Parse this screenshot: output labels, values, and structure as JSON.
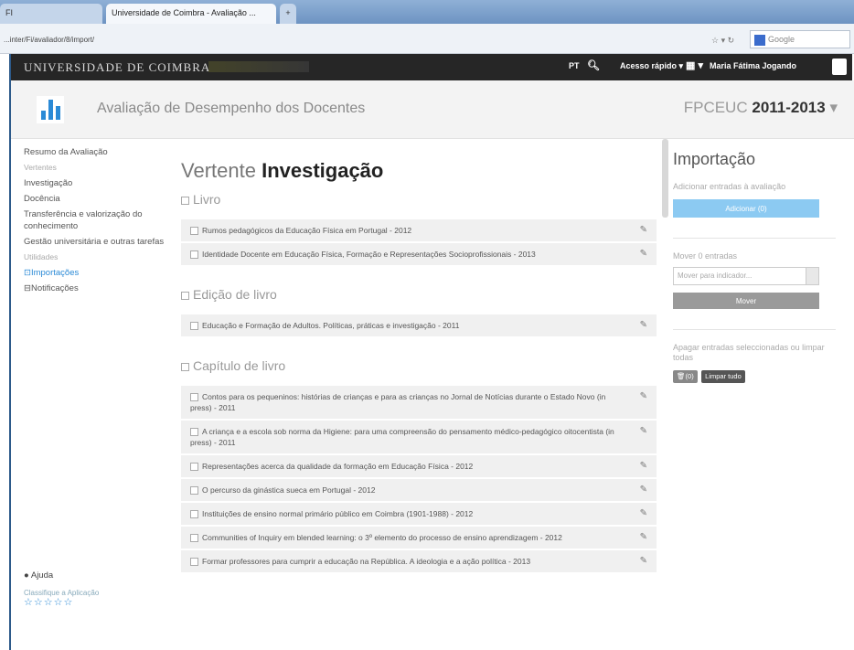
{
  "browser": {
    "tab_prev": "FI",
    "tab_active": "Universidade de Coimbra - Avaliação ...",
    "tab_new": "+",
    "url": "...inter/Fi/avaliador/8/import/",
    "google": "Google"
  },
  "topbar": {
    "logo": "UNIVERSIDADE DE COIMBRA",
    "lang": "PT",
    "quick_access": "Acesso rápido",
    "user_name": "Maria Fátima Jogando"
  },
  "header": {
    "title": "Avaliação de Desempenho dos Docentes",
    "context_org": "FPCEUC",
    "context_period": "2011-2013"
  },
  "sidebar": {
    "summary": "Resumo da Avaliação",
    "vertentes_label": "Vertentes",
    "items": [
      "Investigação",
      "Docência",
      "Transferência e valorização do conhecimento",
      "Gestão universitária e outras tarefas"
    ],
    "utilities_label": "Utilidades",
    "imports": "Importações",
    "notifications": "Notificações",
    "help": "Ajuda",
    "feedback": "Classifique a Aplicação"
  },
  "main": {
    "heading_prefix": "Vertente",
    "heading_main": "Investigação",
    "sections": [
      {
        "title": "Livro",
        "rows": [
          "Rumos pedagógicos da Educação Física em Portugal - 2012",
          "Identidade Docente em Educação Física, Formação e Representações Socioprofissionais - 2013"
        ]
      },
      {
        "title": "Edição de livro",
        "rows": [
          "Educação e Formação de Adultos. Políticas, práticas e investigação - 2011"
        ]
      },
      {
        "title": "Capítulo de livro",
        "rows": [
          "Contos para os pequeninos: histórias de crianças e para as crianças no Jornal de Notícias durante o Estado Novo (in press) - 2011",
          "A criança e a escola sob norma da Higiene: para uma compreensão do pensamento médico-pedagógico oitocentista (in press) - 2011",
          "Representações acerca da qualidade da formação em Educação Física - 2012",
          "O percurso da ginástica sueca em Portugal - 2012",
          "Instituições de ensino normal primário público em Coimbra (1901-1988) - 2012",
          "Communities of Inquiry em blended learning: o 3º elemento do processo de ensino aprendizagem - 2012",
          "Formar professores para cumprir a educação na República. A ideologia e a ação política - 2013"
        ]
      }
    ]
  },
  "panel": {
    "title": "Importação",
    "add_text": "Adicionar entradas à avaliação",
    "add_button": "Adicionar (0)",
    "move_text": "Mover 0 entradas",
    "move_placeholder": "Mover para indicador...",
    "move_button": "Mover",
    "delete_text": "Apagar entradas seleccionadas ou limpar todas",
    "delete_button": "(0)",
    "clear_button": "Limpar tudo"
  }
}
